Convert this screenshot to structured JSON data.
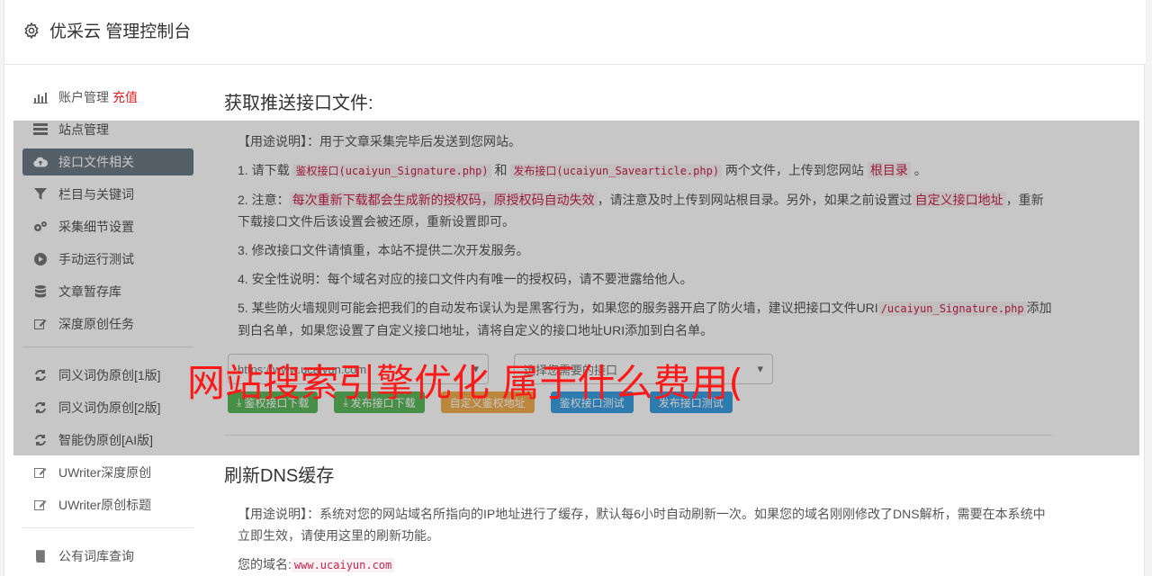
{
  "header": {
    "title": "优采云 管理控制台",
    "icon": "gear-icon"
  },
  "sidebar": {
    "items": [
      {
        "label": "账户管理",
        "icon": "bar-chart-icon",
        "extra": "充值"
      },
      {
        "label": "站点管理",
        "icon": "list-icon"
      },
      {
        "label": "接口文件相关",
        "icon": "cloud-upload-icon",
        "active": true
      },
      {
        "label": "栏目与关键词",
        "icon": "filter-icon"
      },
      {
        "label": "采集细节设置",
        "icon": "cogs-icon"
      },
      {
        "label": "手动运行测试",
        "icon": "play-icon"
      },
      {
        "label": "文章暂存库",
        "icon": "database-icon"
      },
      {
        "label": "深度原创任务",
        "icon": "edit-icon"
      }
    ],
    "items2": [
      {
        "label": "同义词伪原创[1版]",
        "icon": "refresh-icon"
      },
      {
        "label": "同义词伪原创[2版]",
        "icon": "refresh-icon"
      },
      {
        "label": "智能伪原创[AI版]",
        "icon": "refresh-icon"
      },
      {
        "label": "UWriter深度原创",
        "icon": "edit-icon"
      },
      {
        "label": "UWriter原创标题",
        "icon": "edit-icon"
      }
    ],
    "items3": [
      {
        "label": "公有词库查询",
        "icon": "book-icon"
      }
    ]
  },
  "section1": {
    "title": "获取推送接口文件:",
    "usage_label": "【用途说明】",
    "usage_text": "：用于文章采集完毕后发送到您网站。",
    "p1_prefix": "1. 请下载 ",
    "p1_code1": "鉴权接口(ucaiyun_Signature.php)",
    "p1_and": " 和 ",
    "p1_code2": "发布接口(ucaiyun_Savearticle.php)",
    "p1_mid": " 两个文件，上传到您网站 ",
    "p1_code3": "根目录",
    "p1_end": " 。",
    "p2_prefix": "2. 注意：",
    "p2_code1": "每次重新下载都会生成新的授权码，原授权码自动失效",
    "p2_mid": "，请注意及时上传到网站根目录。另外，如果之前设置过",
    "p2_code2": "自定义接口地址",
    "p2_end": "，重新下载接口文件后该设置会被还原，重新设置即可。",
    "p3": "3. 修改接口文件请慎重，本站不提供二次开发服务。",
    "p4": "4. 安全性说明：每个域名对应的接口文件内有唯一的授权码，请不要泄露给他人。",
    "p5_prefix": "5. 某些防火墙规则可能会把我们的自动发布误认为是黑客行为，如果您的服务器开启了防火墙，建议把接口文件URI",
    "p5_code": "/ucaiyun_Signature.php",
    "p5_end": "添加到白名单，如果您设置了自定义接口地址，请将自定义的接口地址URI添加到白名单。",
    "select1": "https://www.ucaiyun.com",
    "select2": "选择您需要的接口",
    "buttons": {
      "b1": "鉴权接口下载",
      "b2": "发布接口下载",
      "b3": "自定义鉴权地址",
      "b4": "鉴权接口测试",
      "b5": "发布接口测试"
    }
  },
  "section2": {
    "title": "刷新DNS缓存",
    "usage_label": "【用途说明】",
    "usage_text": "：系统对您的网站域名所指向的IP地址进行了缓存，默认每6小时自动刷新一次。如果您的域名刚刚修改了DNS解析，需要在本系统中立即生效，请使用这里的刷新功能。",
    "domain_label": "您的域名:",
    "domain_value": "www.ucaiyun.com"
  },
  "watermark": "网站搜索引擎优化 属于什么费用("
}
